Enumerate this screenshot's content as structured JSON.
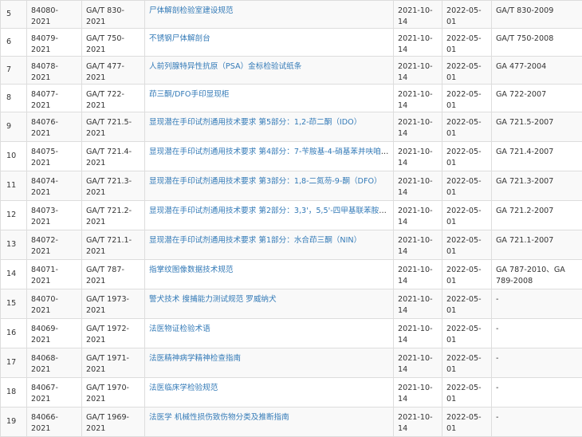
{
  "rows": [
    {
      "no": "5",
      "id": "84080-2021",
      "code": "GA/T 830-2021",
      "title": "尸体解剖检验室建设规范",
      "issued": "2021-10-14",
      "effective": "2022-05-01",
      "replaces": "GA/T 830-2009"
    },
    {
      "no": "6",
      "id": "84079-2021",
      "code": "GA/T 750-2021",
      "title": "不锈钢尸体解剖台",
      "issued": "2021-10-14",
      "effective": "2022-05-01",
      "replaces": "GA/T 750-2008"
    },
    {
      "no": "7",
      "id": "84078-2021",
      "code": "GA/T 477-2021",
      "title": "人前列腺特异性抗原（PSA）金标检验试纸条",
      "issued": "2021-10-14",
      "effective": "2022-05-01",
      "replaces": "GA 477-2004"
    },
    {
      "no": "8",
      "id": "84077-2021",
      "code": "GA/T 722-2021",
      "title": "茚三酮/DFO手印显现柜",
      "issued": "2021-10-14",
      "effective": "2022-05-01",
      "replaces": "GA 722-2007"
    },
    {
      "no": "9",
      "id": "84076-2021",
      "code": "GA/T 721.5-2021",
      "title": "显现潜在手印试剂通用技术要求 第5部分：1,2-茚二酮（IDO）",
      "issued": "2021-10-14",
      "effective": "2022-05-01",
      "replaces": "GA 721.5-2007"
    },
    {
      "no": "10",
      "id": "84075-2021",
      "code": "GA/T 721.4-2021",
      "title": "显现潜在手印试剂通用技术要求 第4部分：7-苄胺基-4-硝基苯并呋咱（…",
      "issued": "2021-10-14",
      "effective": "2022-05-01",
      "replaces": "GA 721.4-2007"
    },
    {
      "no": "11",
      "id": "84074-2021",
      "code": "GA/T 721.3-2021",
      "title": "显现潜在手印试剂通用技术要求 第3部分：1,8-二氮芴-9-酮（DFO）",
      "issued": "2021-10-14",
      "effective": "2022-05-01",
      "replaces": "GA 721.3-2007"
    },
    {
      "no": "12",
      "id": "84073-2021",
      "code": "GA/T 721.2-2021",
      "title": "显现潜在手印试剂通用技术要求 第2部分：3,3'，5,5'-四甲基联苯胺（T…",
      "issued": "2021-10-14",
      "effective": "2022-05-01",
      "replaces": "GA 721.2-2007"
    },
    {
      "no": "13",
      "id": "84072-2021",
      "code": "GA/T 721.1-2021",
      "title": "显现潜在手印试剂通用技术要求 第1部分：水合茚三酮（NIN）",
      "issued": "2021-10-14",
      "effective": "2022-05-01",
      "replaces": "GA 721.1-2007"
    },
    {
      "no": "14",
      "id": "84071-2021",
      "code": "GA/T 787-2021",
      "title": "指掌纹图像数据技术规范",
      "issued": "2021-10-14",
      "effective": "2022-05-01",
      "replaces": "GA 787-2010、GA 789-2008"
    },
    {
      "no": "15",
      "id": "84070-2021",
      "code": "GA/T 1973-2021",
      "title": "警犬技术 搜捕能力测试规范 罗威纳犬",
      "issued": "2021-10-14",
      "effective": "2022-05-01",
      "replaces": "-"
    },
    {
      "no": "16",
      "id": "84069-2021",
      "code": "GA/T 1972-2021",
      "title": "法医物证检验术语",
      "issued": "2021-10-14",
      "effective": "2022-05-01",
      "replaces": "-"
    },
    {
      "no": "17",
      "id": "84068-2021",
      "code": "GA/T 1971-2021",
      "title": "法医精神病学精神检查指南",
      "issued": "2021-10-14",
      "effective": "2022-05-01",
      "replaces": "-"
    },
    {
      "no": "18",
      "id": "84067-2021",
      "code": "GA/T 1970-2021",
      "title": "法医临床学检验规范",
      "issued": "2021-10-14",
      "effective": "2022-05-01",
      "replaces": "-"
    },
    {
      "no": "19",
      "id": "84066-2021",
      "code": "GA/T 1969-2021",
      "title": "法医学 机械性损伤致伤物分类及推断指南",
      "issued": "2021-10-14",
      "effective": "2022-05-01",
      "replaces": "-"
    }
  ]
}
